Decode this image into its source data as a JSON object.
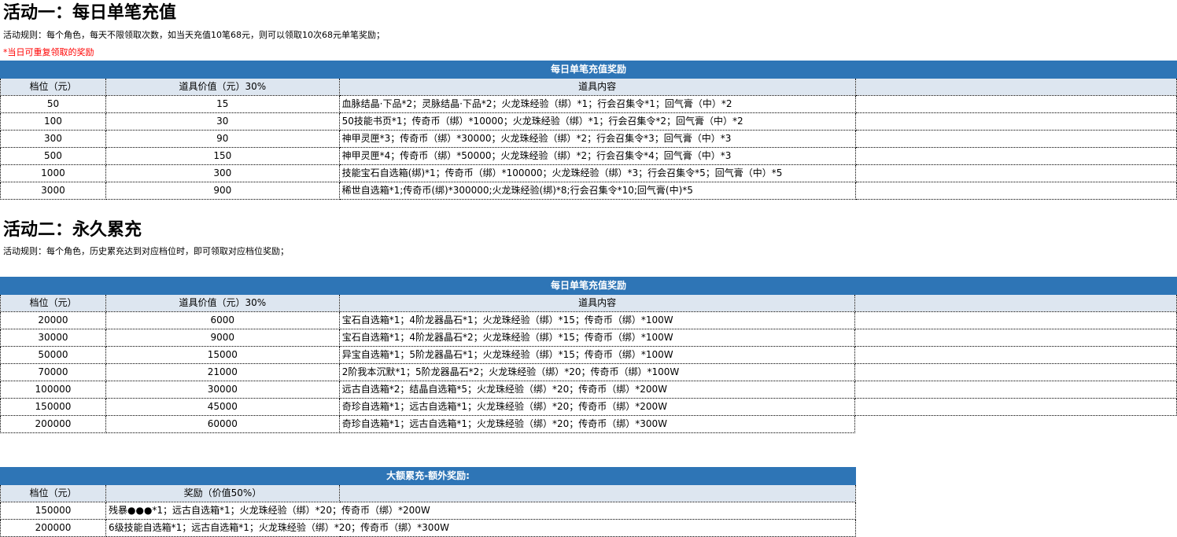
{
  "activity1": {
    "title": "活动一：每日单笔充值",
    "rule": "活动规则：每个角色，每天不限领取次数，如当天充值10笔68元，则可以领取10次68元单笔奖励；",
    "note": "*当日可重复领取的奖励",
    "table": {
      "title": "每日单笔充值奖励",
      "headers": [
        "档位（元）",
        "道具价值（元）30%",
        "道具内容"
      ],
      "rows": [
        [
          "50",
          "15",
          "血脉结晶·下品*2；灵脉结晶·下品*2；火龙珠经验（绑）*1；行会召集令*1；回气膏（中）*2"
        ],
        [
          "100",
          "30",
          "50技能书页*1；传奇币（绑）*10000；火龙珠经验（绑）*1；行会召集令*2；回气膏（中）*2"
        ],
        [
          "300",
          "90",
          "神甲灵匣*3；传奇币（绑）*30000；火龙珠经验（绑）*2；行会召集令*3；回气膏（中）*3"
        ],
        [
          "500",
          "150",
          "神甲灵匣*4；传奇币（绑）*50000；火龙珠经验（绑）*2；行会召集令*4；回气膏（中）*3"
        ],
        [
          "1000",
          "300",
          "技能宝石自选箱(绑)*1；传奇币（绑）*100000；火龙珠经验（绑）*3；行会召集令*5；回气膏（中）*5"
        ],
        [
          "3000",
          "900",
          "稀世自选箱*1;传奇币(绑)*300000;火龙珠经验(绑)*8;行会召集令*10;回气膏(中)*5"
        ]
      ]
    }
  },
  "activity2": {
    "title": "活动二：永久累充",
    "rule": "活动规则：每个角色，历史累充达到对应档位时，即可领取对应档位奖励；",
    "table": {
      "title": "每日单笔充值奖励",
      "headers": [
        "档位（元）",
        "道具价值（元）30%",
        "道具内容"
      ],
      "rows": [
        [
          "20000",
          "6000",
          "宝石自选箱*1；4阶龙器晶石*1；火龙珠经验（绑）*15；传奇币（绑）*100W"
        ],
        [
          "30000",
          "9000",
          "宝石自选箱*1；4阶龙器晶石*2；火龙珠经验（绑）*15；传奇币（绑）*100W"
        ],
        [
          "50000",
          "15000",
          "异宝自选箱*1；5阶龙器晶石*1；火龙珠经验（绑）*15；传奇币（绑）*100W"
        ],
        [
          "70000",
          "21000",
          "2阶我本沉默*1；5阶龙器晶石*2；火龙珠经验（绑）*20；传奇币（绑）*100W"
        ],
        [
          "100000",
          "30000",
          "远古自选箱*2；结晶自选箱*5；火龙珠经验（绑）*20；传奇币（绑）*200W"
        ],
        [
          "150000",
          "45000",
          "奇珍自选箱*1；远古自选箱*1；火龙珠经验（绑）*20；传奇币（绑）*200W"
        ],
        [
          "200000",
          "60000",
          "奇珍自选箱*1；远古自选箱*1；火龙珠经验（绑）*20；传奇币（绑）*300W"
        ]
      ]
    }
  },
  "extra": {
    "table": {
      "title": "大额累充-额外奖励:",
      "headers": [
        "档位（元）",
        "奖励（价值50%）"
      ],
      "rows": [
        [
          "150000",
          "残暴●●●*1；远古自选箱*1；火龙珠经验（绑）*20；传奇币（绑）*200W"
        ],
        [
          "200000",
          "6级技能自选箱*1；远古自选箱*1；火龙珠经验（绑）*20；传奇币（绑）*300W"
        ]
      ]
    }
  },
  "colors": {
    "header_bar": "#2e75b6",
    "column_header_bg": "#dde6f0",
    "note_text": "#ff0000"
  }
}
